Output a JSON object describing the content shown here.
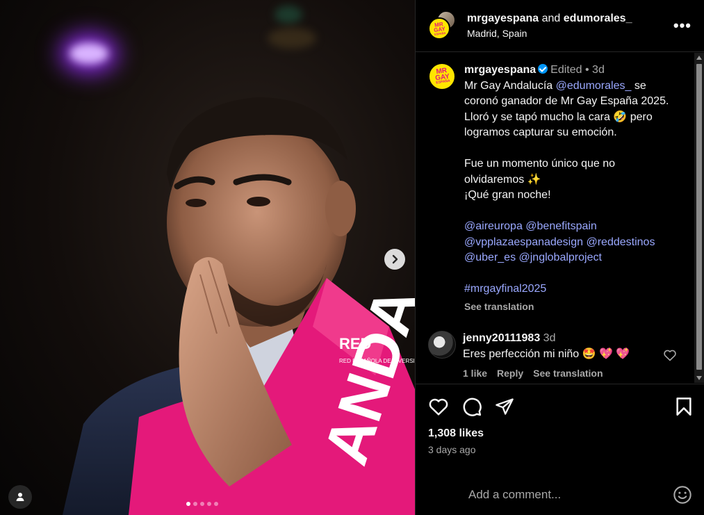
{
  "header": {
    "user1": "mrgayespana",
    "joiner": " and ",
    "user2": "edumorales_",
    "location": "Madrid, Spain",
    "more_label": "•••"
  },
  "logo": {
    "line1": "MR",
    "line2": "GAY",
    "line3": "ESPAÑA"
  },
  "caption": {
    "username": "mrgayespana",
    "edited": "Edited",
    "dot": " • ",
    "age": "3d",
    "line1_pre": "Mr Gay Andalucía ",
    "line1_mention": "@edumorales_",
    "line1_post": " se coronó ganador de Mr Gay España 2025. Lloró y se tapó mucho la cara 🤣 pero logramos capturar su emoción.",
    "para2_line1": "Fue un momento único que no olvidaremos ✨",
    "para2_line2": "¡Qué gran noche!",
    "tags_line1": "@aireuropa @benefitspain",
    "tags_line2": "@vpplazaespanadesign @reddestinos",
    "tags_line3": "@uber_es @jnglobalproject",
    "hashtag": "#mrgayfinal2025",
    "see_translation": "See translation"
  },
  "comment": {
    "username": "jenny20111983",
    "age": "3d",
    "text": "Eres perfección mi niño 🤩 💖 💖",
    "likes": "1 like",
    "reply": "Reply",
    "see_translation": "See translation"
  },
  "post": {
    "likes": "1,308 likes",
    "time": "3 days ago"
  },
  "add_comment": {
    "placeholder": "Add a comment..."
  },
  "photo": {
    "sash_text": "ANDA",
    "sash_logo": "RED",
    "sash_subtext": "RED ESPAÑOLA DE DIVERSIDAD",
    "carousel_count": 5,
    "carousel_active": 1
  },
  "colors": {
    "accent_pink": "#e4197a",
    "logo_yellow": "#ffe500",
    "mention_blue": "#9aa8ff",
    "verified_blue": "#0095f6"
  }
}
